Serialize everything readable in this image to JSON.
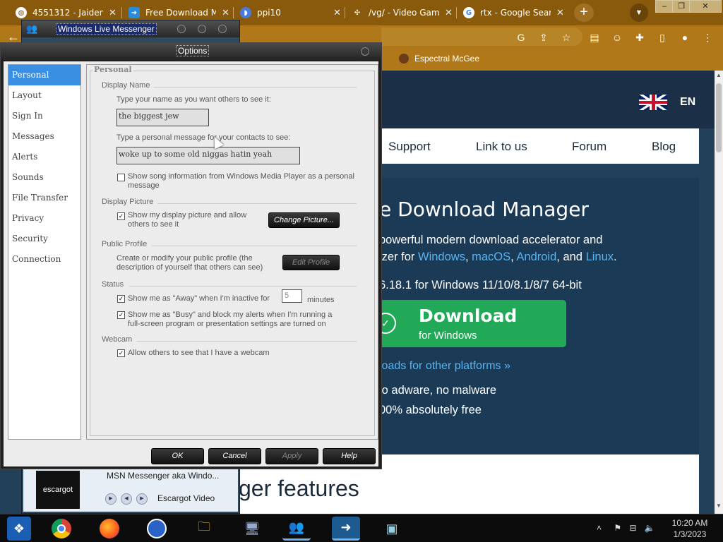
{
  "browser": {
    "tabs": [
      {
        "label": "4551312 - Jaiden",
        "icon": "globe-icon"
      },
      {
        "label": "Free Download M",
        "icon": "download-icon"
      },
      {
        "label": "ppi10",
        "icon": "discord-icon"
      },
      {
        "label": "/vg/ - Video Game",
        "icon": "clover-icon"
      },
      {
        "label": "rtx - Google Sear",
        "icon": "google-icon"
      }
    ],
    "bookmark": "Espectral McGee"
  },
  "website": {
    "language": "EN",
    "nav": [
      "Support",
      "Link to us",
      "Forum",
      "Blog"
    ],
    "hero_title": "e Download Manager",
    "hero_line1": "powerful modern download accelerator and",
    "hero_line2_prefix": "izer for ",
    "platforms": [
      "Windows",
      "macOS",
      "Android",
      "Linux"
    ],
    "version": "6.18.1 for Windows 11/10/8.1/8/7 64-bit",
    "download_title": "Download",
    "download_sub": "for Windows",
    "other_platforms": "loads for other platforms",
    "feature1": "lo adware, no malware",
    "feature2": "00% absolutely free",
    "features_heading": "ger features"
  },
  "messenger": {
    "title": "Windows Live Messenger",
    "song": "MSN Messenger aka Windo...",
    "video_label": "Escargot Video",
    "thumb_label": "escargot"
  },
  "options": {
    "title": "Options",
    "sidebar": [
      "Personal",
      "Layout",
      "Sign In",
      "Messages",
      "Alerts",
      "Sounds",
      "File Transfer",
      "Privacy",
      "Security",
      "Connection"
    ],
    "legend": "Personal",
    "display_name_header": "Display Name",
    "name_prompt": "Type your name as you want others to see it:",
    "name_value": "the biggest jew",
    "message_prompt": "Type a personal message for your contacts to see:",
    "message_value": "woke up to some old niggas hatin yeah",
    "song_info": "Show song information from Windows Media Player as a personal message",
    "display_picture_header": "Display Picture",
    "show_picture": "Show my display picture and allow others to see it",
    "change_picture": "Change Picture...",
    "public_profile_header": "Public Profile",
    "profile_desc": "Create or modify your public profile (the description of yourself that others can see)",
    "edit_profile": "Edit Profile",
    "status_header": "Status",
    "away_label": "Show me as \"Away\" when I'm inactive for",
    "away_minutes": "5",
    "minutes_label": "minutes",
    "busy_label": "Show me as \"Busy\" and block my alerts when I'm running a full-screen program or presentation settings are turned on",
    "webcam_header": "Webcam",
    "webcam_label": "Allow others to see that I have a webcam",
    "buttons": {
      "ok": "OK",
      "cancel": "Cancel",
      "apply": "Apply",
      "help": "Help"
    }
  },
  "taskbar": {
    "time": "10:20 AM",
    "date": "1/3/2023"
  }
}
